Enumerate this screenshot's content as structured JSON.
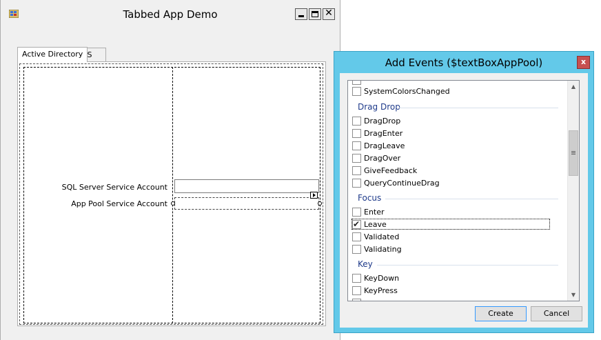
{
  "main_window": {
    "title": "Tabbed App Demo",
    "tabs": [
      {
        "label": "Active Directory",
        "active": true
      },
      {
        "label": "IIS",
        "active": false
      }
    ],
    "fields": [
      {
        "label": "SQL Server Service Account",
        "value": ""
      },
      {
        "label": "App Pool Service Account",
        "value": ""
      }
    ]
  },
  "dialog": {
    "title": "Add Events ($textBoxAppPool)",
    "close_glyph": "x",
    "partial_item": "SystemColorsChanged",
    "groups": [
      {
        "name": "Drag Drop",
        "items": [
          {
            "label": "DragDrop",
            "checked": false
          },
          {
            "label": "DragEnter",
            "checked": false
          },
          {
            "label": "DragLeave",
            "checked": false
          },
          {
            "label": "DragOver",
            "checked": false
          },
          {
            "label": "GiveFeedback",
            "checked": false
          },
          {
            "label": "QueryContinueDrag",
            "checked": false
          }
        ]
      },
      {
        "name": "Focus",
        "items": [
          {
            "label": "Enter",
            "checked": false
          },
          {
            "label": "Leave",
            "checked": true
          },
          {
            "label": "Validated",
            "checked": false
          },
          {
            "label": "Validating",
            "checked": false
          }
        ]
      },
      {
        "name": "Key",
        "items": [
          {
            "label": "KeyDown",
            "checked": false
          },
          {
            "label": "KeyPress",
            "checked": false
          }
        ]
      }
    ],
    "buttons": {
      "create": "Create",
      "cancel": "Cancel"
    }
  },
  "colors": {
    "dialog_frame": "#63c9e9",
    "close_red": "#c75050",
    "group_header": "#1e3a8a"
  },
  "icons": [
    "app-form-icon",
    "minimize-icon",
    "maximize-icon",
    "close-icon",
    "scroll-up-icon",
    "scroll-down-icon",
    "checkmark-icon",
    "smart-tag-arrow-icon"
  ]
}
